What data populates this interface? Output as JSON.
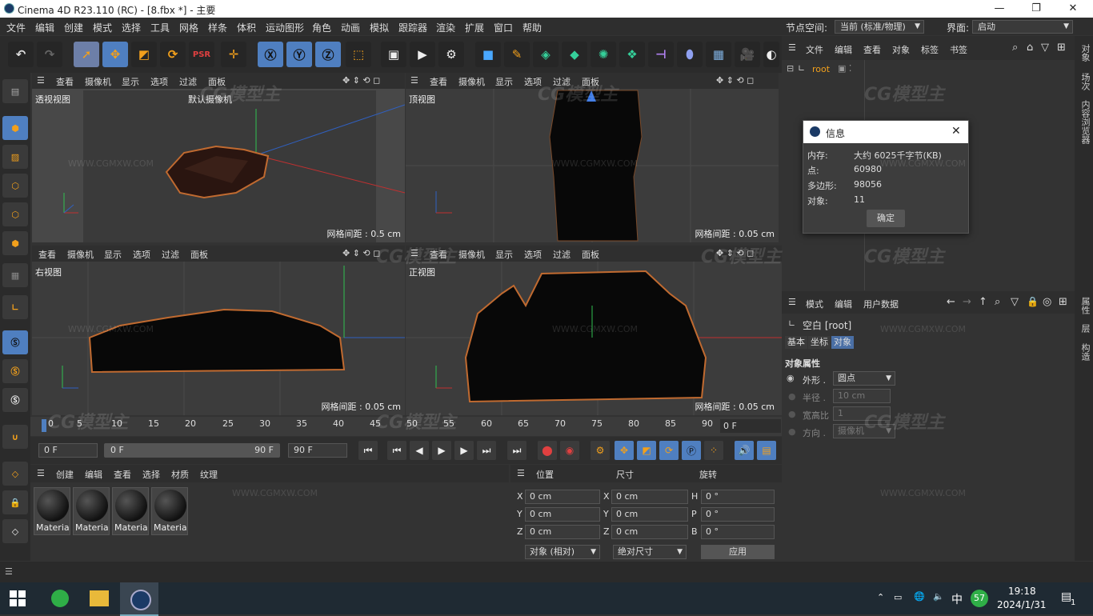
{
  "window": {
    "title": "Cinema 4D R23.110 (RC) - [8.fbx *] - 主要",
    "minimize": "—",
    "maximize": "❐",
    "close": "✕"
  },
  "menu": [
    "文件",
    "编辑",
    "创建",
    "模式",
    "选择",
    "工具",
    "网格",
    "样条",
    "体积",
    "运动图形",
    "角色",
    "动画",
    "模拟",
    "跟踪器",
    "渲染",
    "扩展",
    "窗口",
    "帮助"
  ],
  "node_space": {
    "label": "节点空间:",
    "value": "当前 (标准/物理)"
  },
  "layout": {
    "label": "界面:",
    "value": "启动"
  },
  "viewport_menu": [
    "查看",
    "摄像机",
    "显示",
    "选项",
    "过滤",
    "面板"
  ],
  "viewports": {
    "persp": {
      "name": "透视视图",
      "camera": "默认摄像机",
      "grid": "网格间距 : 0.5 cm"
    },
    "top": {
      "name": "顶视图",
      "grid": "网格间距 : 0.05 cm"
    },
    "right": {
      "name": "右视图",
      "grid": "网格间距 : 0.05 cm"
    },
    "front": {
      "name": "正视图",
      "grid": "网格间距 : 0.05 cm"
    }
  },
  "timeline": {
    "ticks": [
      "0",
      "5",
      "10",
      "15",
      "20",
      "25",
      "30",
      "35",
      "40",
      "45",
      "50",
      "55",
      "60",
      "65",
      "70",
      "75",
      "80",
      "85",
      "90"
    ],
    "current": "0 F"
  },
  "transport": {
    "start": "0 F",
    "range_start": "0 F",
    "range_end": "90 F",
    "end": "90 F"
  },
  "material_menu": [
    "创建",
    "编辑",
    "查看",
    "选择",
    "材质",
    "纹理"
  ],
  "materials": [
    "Materia",
    "Materia",
    "Materia",
    "Materia"
  ],
  "coords": {
    "headers": [
      "位置",
      "尺寸",
      "旋转"
    ],
    "rows": [
      {
        "a": "X",
        "pos": "0 cm",
        "b": "X",
        "size": "0 cm",
        "c": "H",
        "rot": "0 °"
      },
      {
        "a": "Y",
        "pos": "0 cm",
        "b": "Y",
        "size": "0 cm",
        "c": "P",
        "rot": "0 °"
      },
      {
        "a": "Z",
        "pos": "0 cm",
        "b": "Z",
        "size": "0 cm",
        "c": "B",
        "rot": "0 °"
      }
    ],
    "mode": "对象 (相对)",
    "size_mode": "绝对尺寸",
    "apply": "应用"
  },
  "object_manager": {
    "menu": [
      "文件",
      "编辑",
      "查看",
      "对象",
      "标签",
      "书签"
    ],
    "root": "root"
  },
  "attributes": {
    "menu": [
      "模式",
      "编辑",
      "用户数据"
    ],
    "title": "空白 [root]",
    "tabs": [
      "基本",
      "坐标",
      "对象"
    ],
    "section": "对象属性",
    "fields": [
      {
        "label": "外形 .",
        "value": "圆点"
      },
      {
        "label": "半径 .",
        "value": "10 cm"
      },
      {
        "label": "宽高比",
        "value": "1"
      },
      {
        "label": "方向 .",
        "value": "摄像机"
      }
    ]
  },
  "right_tabs": [
    "对象",
    "场次",
    "内容浏览器",
    "属性",
    "层",
    "构造"
  ],
  "info_dialog": {
    "title": "信息",
    "rows": [
      {
        "label": "内存:",
        "value": "大约 6025千字节(KB)"
      },
      {
        "label": "点:",
        "value": "60980"
      },
      {
        "label": "多边形:",
        "value": "98056"
      },
      {
        "label": "对象:",
        "value": "11"
      }
    ],
    "ok": "确定"
  },
  "watermark": {
    "brand": "CG模型主",
    "url": "WWW.CGMXW.COM"
  },
  "taskbar": {
    "time": "19:18",
    "date": "2024/1/31",
    "ime": "中",
    "badge": "57",
    "notif": "1"
  },
  "colors": {
    "accent": "#4f7fc0",
    "selection": "#4a6fa5",
    "orange_outline": "#c06a30"
  }
}
